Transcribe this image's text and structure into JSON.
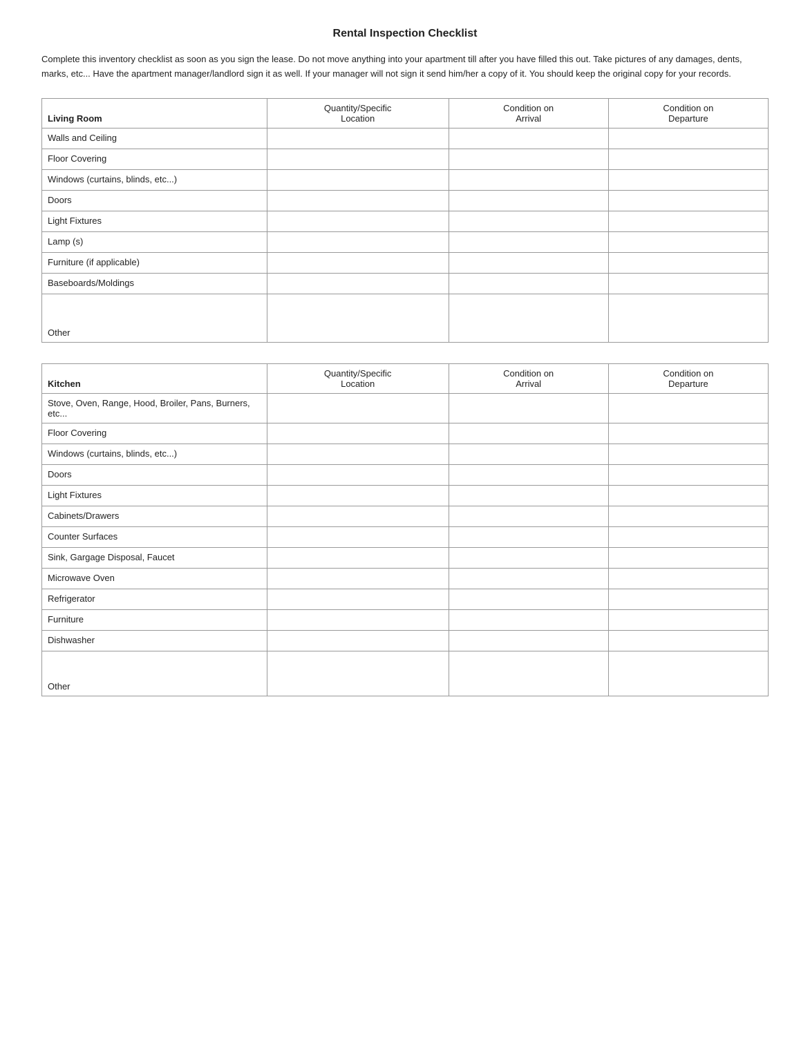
{
  "title": "Rental Inspection Checklist",
  "intro": "Complete this inventory checklist as soon as you sign the lease.  Do not move anything into your apartment till after you have filled this out.  Take pictures of any damages, dents, marks, etc... Have the apartment manager/landlord sign it as well.  If your manager will not sign it send him/her a copy of it. You should keep the original copy for your records.",
  "livingRoom": {
    "sectionLabel": "Living Room",
    "headers": {
      "item": "Living Room",
      "qty": "Quantity/Specific Location",
      "arrival": "Condition on Arrival",
      "departure": "Condition on Departure"
    },
    "rows": [
      {
        "item": "Walls and Ceiling"
      },
      {
        "item": "Floor Covering"
      },
      {
        "item": "Windows (curtains, blinds, etc...)"
      },
      {
        "item": "Doors"
      },
      {
        "item": "Light Fixtures"
      },
      {
        "item": "Lamp (s)"
      },
      {
        "item": "Furniture (if applicable)"
      },
      {
        "item": "Baseboards/Moldings"
      },
      {
        "item": "Other",
        "tall": true
      }
    ]
  },
  "kitchen": {
    "sectionLabel": "Kitchen",
    "headers": {
      "item": "Kitchen",
      "qty": "Quantity/Specific Location",
      "arrival": "Condition on Arrival",
      "departure": "Condition on Departure"
    },
    "rows": [
      {
        "item": "Stove, Oven, Range, Hood, Broiler, Pans, Burners, etc..."
      },
      {
        "item": "Floor Covering"
      },
      {
        "item": "Windows (curtains, blinds, etc...)"
      },
      {
        "item": "Doors"
      },
      {
        "item": "Light Fixtures"
      },
      {
        "item": "Cabinets/Drawers"
      },
      {
        "item": "Counter Surfaces"
      },
      {
        "item": "Sink, Gargage Disposal, Faucet"
      },
      {
        "item": "Microwave Oven"
      },
      {
        "item": "Refrigerator"
      },
      {
        "item": "Furniture"
      },
      {
        "item": "Dishwasher"
      },
      {
        "item": "Other",
        "tall": true
      }
    ]
  }
}
